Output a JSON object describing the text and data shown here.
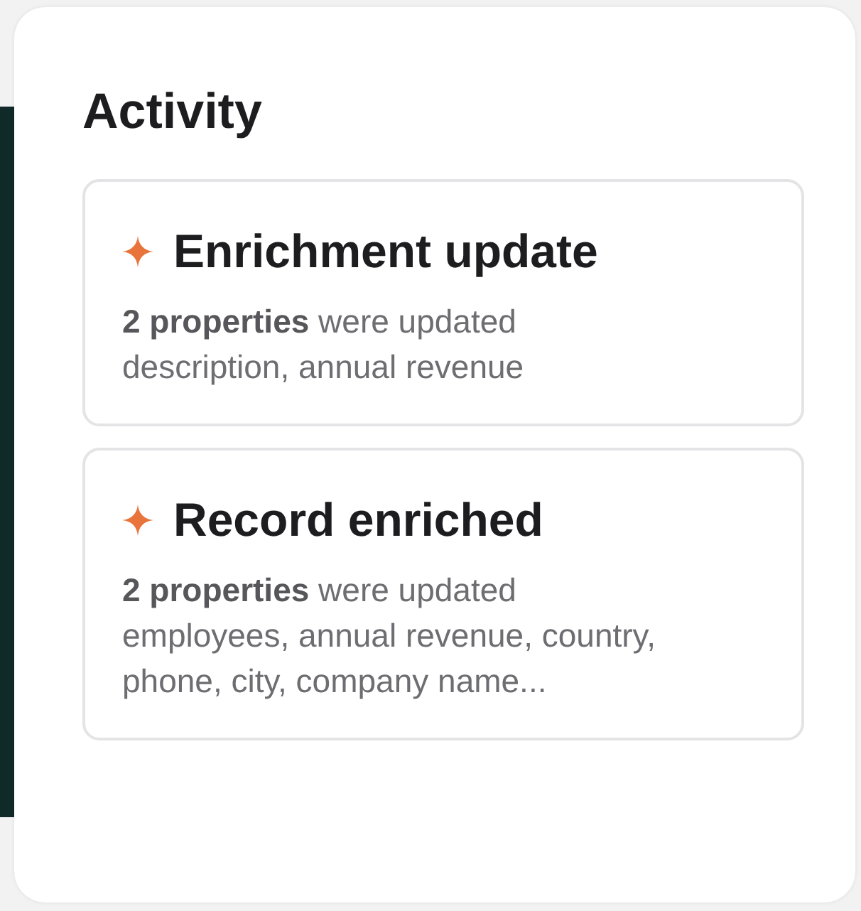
{
  "panel": {
    "title": "Activity"
  },
  "activities": [
    {
      "title": "Enrichment update",
      "summary": "**2 properties** were updated",
      "details": "description, annual revenue"
    },
    {
      "title": "Record enriched",
      "summary": "**2 properties** were updated",
      "details": "employees, annual revenue, country, phone, city, company name..."
    }
  ]
}
